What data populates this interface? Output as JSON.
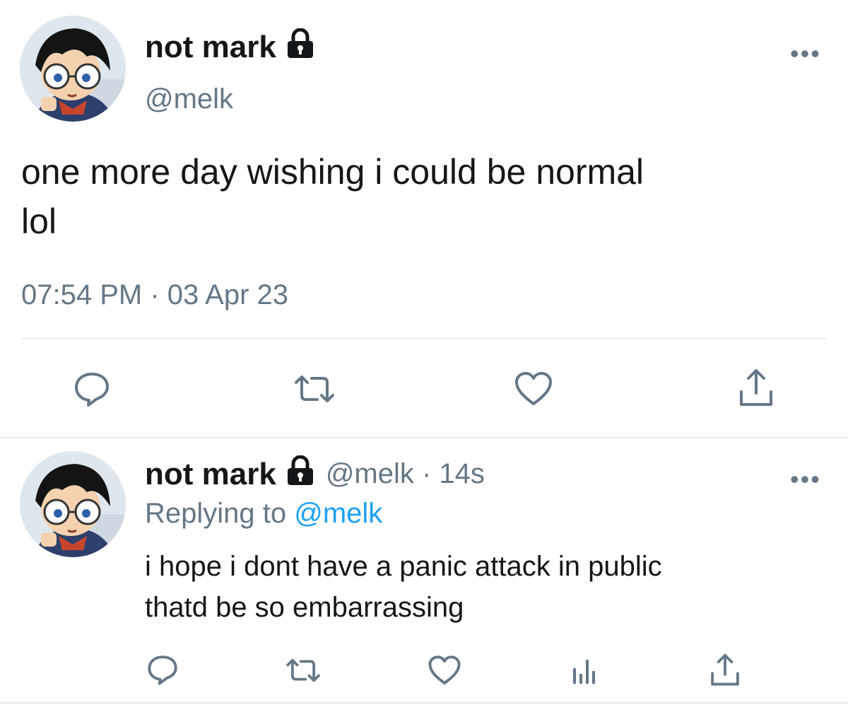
{
  "main_tweet": {
    "display_name": "not mark",
    "handle": "@melk",
    "text_line1": "one more day wishing i could be normal",
    "text_line2": "lol",
    "timestamp": "07:54 PM · 03 Apr 23",
    "more_label": "•••"
  },
  "reply_tweet": {
    "display_name": "not mark",
    "handle_time": "@melk · 14s",
    "replying_prefix": "Replying to",
    "replying_handle": "@melk",
    "text_line1": "i hope i dont have a panic attack in public",
    "text_line2": "thatd be so embarrassing",
    "more_label": "•••"
  },
  "icons": {
    "main_actions": [
      "reply-icon",
      "retweet-icon",
      "like-icon",
      "share-icon"
    ],
    "reply_actions": [
      "reply-icon",
      "retweet-icon",
      "like-icon",
      "analytics-icon",
      "share-icon"
    ],
    "protected": "lock-icon"
  },
  "colors": {
    "text_primary": "#14171a",
    "text_secondary": "#657786",
    "link": "#1da1f2",
    "divider": "#e6ecf0"
  }
}
